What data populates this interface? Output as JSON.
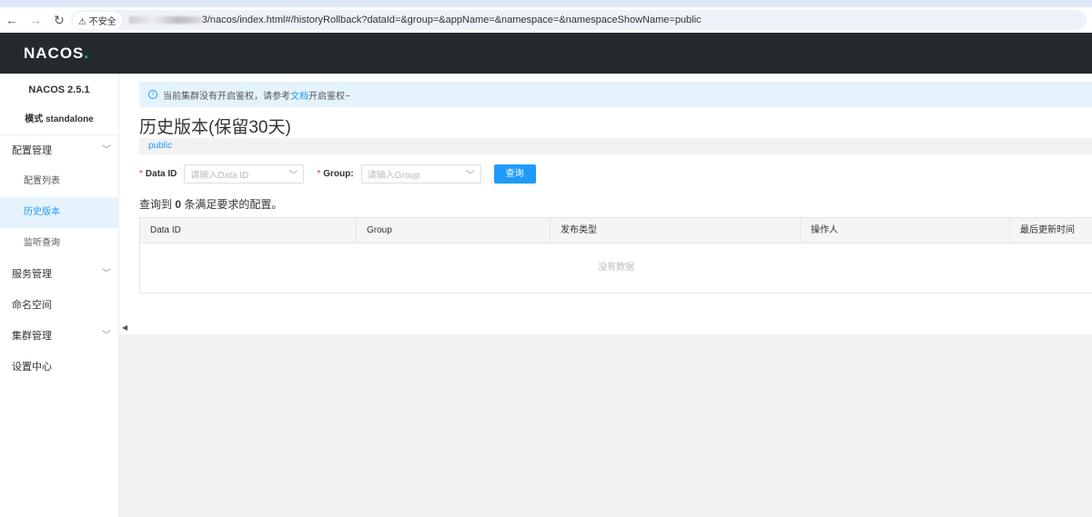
{
  "browser": {
    "security": "不安全",
    "url": "3/nacos/index.html#/historyRollback?dataId=&group=&appName=&namespace=&namespaceShowName=public"
  },
  "header": {
    "logo": "NACOS",
    "logo_dot": "."
  },
  "sidebar": {
    "version": "NACOS 2.5.1",
    "mode": "模式 standalone",
    "items": [
      {
        "label": "配置管理"
      },
      {
        "label": "配置列表"
      },
      {
        "label": "历史版本"
      },
      {
        "label": "监听查询"
      },
      {
        "label": "服务管理"
      },
      {
        "label": "命名空间"
      },
      {
        "label": "集群管理"
      },
      {
        "label": "设置中心"
      }
    ]
  },
  "alert": {
    "before": "当前集群没有开启鉴权，请参考",
    "link": "文档",
    "after": "开启鉴权~"
  },
  "page": {
    "title": "历史版本(保留30天)",
    "namespace": "public"
  },
  "form": {
    "dataid_label": "Data ID",
    "dataid_placeholder": "请输入Data ID",
    "group_label": "Group:",
    "group_placeholder": "请输入Group",
    "search": "查询"
  },
  "result": {
    "prefix": "查询到 ",
    "count": "0",
    "suffix": " 条满足要求的配置。"
  },
  "table": {
    "columns": [
      "Data ID",
      "Group",
      "发布类型",
      "操作人",
      "最后更新时间"
    ],
    "empty": "没有数据"
  }
}
